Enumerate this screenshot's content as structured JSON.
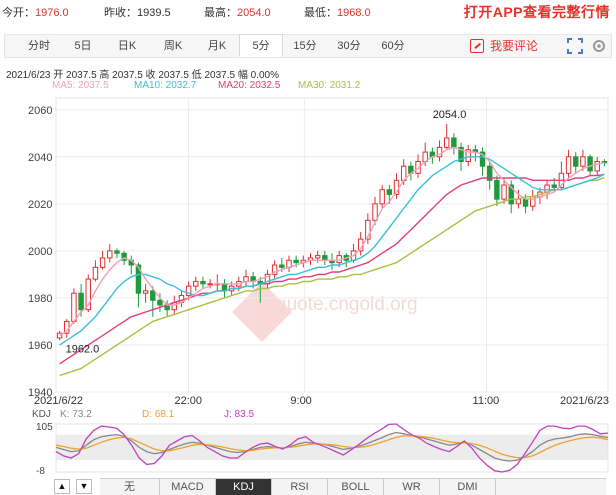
{
  "quote": {
    "open_label": "今开：",
    "open_value": "1976.0",
    "prev_label": "昨收：",
    "prev_value": "1939.5",
    "high_label": "最高：",
    "high_value": "2054.0",
    "low_label": "最低：",
    "low_value": "1968.0",
    "app_cta": "打开APP查看完整行情"
  },
  "tabs": [
    {
      "label": "分时"
    },
    {
      "label": "5日"
    },
    {
      "label": "日K"
    },
    {
      "label": "周K"
    },
    {
      "label": "月K"
    },
    {
      "label": "5分",
      "active": true
    },
    {
      "label": "15分"
    },
    {
      "label": "30分"
    },
    {
      "label": "60分"
    }
  ],
  "comment_label": "我要评论",
  "info_line": "2021/6/23  开 2037.5  高 2037.5  收 2037.5  低 2037.5  幅 0.00%",
  "ma": {
    "ma5": "MA5: 2037.5",
    "ma10": "MA10: 2032.7",
    "ma20": "MA20: 2032.5",
    "ma30": "MA30: 2031.2"
  },
  "colors": {
    "ma5": "#f0a0b8",
    "ma10": "#38c0d8",
    "ma20": "#e0407a",
    "ma30": "#a8c040",
    "up": "#e03030",
    "down": "#1f9a3c",
    "k": "#888888",
    "d": "#f0a030",
    "j": "#c040c0",
    "brand_red": "#e5322d"
  },
  "watermark": "quote.cngold.org",
  "kdj": {
    "label": "KDJ",
    "k": "K: 73.2",
    "d": "D: 68.1",
    "j": "J: 83.5"
  },
  "indicators": [
    {
      "label": "无"
    },
    {
      "label": "MACD"
    },
    {
      "label": "KDJ",
      "active": true
    },
    {
      "label": "RSI"
    },
    {
      "label": "BOLL"
    },
    {
      "label": "WR"
    },
    {
      "label": "DMI"
    }
  ],
  "nav": {
    "up": "▲",
    "down": "▼"
  },
  "chart_data": {
    "type": "candlestick",
    "ylim": [
      1940,
      2065
    ],
    "y_ticks": [
      "2060",
      "2040",
      "2020",
      "2000",
      "1980",
      "1960",
      "1940"
    ],
    "x_labels": [
      "2021/6/22",
      "22:00",
      "9:00",
      "11:00",
      "2021/6/23"
    ],
    "annotations": [
      {
        "text": "2054.0"
      },
      {
        "text": "1962.0"
      }
    ],
    "candles": [
      [
        1963,
        1965,
        1966,
        1962
      ],
      [
        1965,
        1970,
        1971,
        1963
      ],
      [
        1970,
        1982,
        1984,
        1969
      ],
      [
        1982,
        1975,
        1986,
        1972
      ],
      [
        1975,
        1988,
        1990,
        1974
      ],
      [
        1988,
        1993,
        1996,
        1987
      ],
      [
        1993,
        1997,
        2000,
        1992
      ],
      [
        1997,
        2000,
        2003,
        1995
      ],
      [
        2000,
        1999,
        2001,
        1997
      ],
      [
        1999,
        1996,
        2000,
        1994
      ],
      [
        1996,
        1994,
        1998,
        1990
      ],
      [
        1994,
        1982,
        1995,
        1976
      ],
      [
        1982,
        1983,
        1986,
        1978
      ],
      [
        1983,
        1979,
        1985,
        1972
      ],
      [
        1979,
        1977,
        1982,
        1974
      ],
      [
        1977,
        1975,
        1979,
        1972
      ],
      [
        1975,
        1978,
        1981,
        1973
      ],
      [
        1978,
        1981,
        1983,
        1976
      ],
      [
        1981,
        1985,
        1987,
        1979
      ],
      [
        1985,
        1987,
        1989,
        1983
      ],
      [
        1987,
        1986,
        1989,
        1984
      ],
      [
        1986,
        1986,
        1988,
        1984
      ],
      [
        1986,
        1986,
        1990,
        1983
      ],
      [
        1986,
        1983,
        1988,
        1980
      ],
      [
        1983,
        1985,
        1987,
        1981
      ],
      [
        1985,
        1987,
        1989,
        1983
      ],
      [
        1987,
        1989,
        1992,
        1985
      ],
      [
        1989,
        1987,
        1991,
        1984
      ],
      [
        1987,
        1986,
        1989,
        1978
      ],
      [
        1986,
        1990,
        1992,
        1984
      ],
      [
        1990,
        1994,
        1996,
        1988
      ],
      [
        1994,
        1993,
        1997,
        1991
      ],
      [
        1993,
        1996,
        1998,
        1991
      ],
      [
        1996,
        1995,
        1998,
        1993
      ],
      [
        1995,
        1996,
        1998,
        1993
      ],
      [
        1996,
        1997,
        1999,
        1994
      ],
      [
        1997,
        1998,
        2000,
        1995
      ],
      [
        1998,
        1996,
        2000,
        1994
      ],
      [
        1996,
        1995,
        1999,
        1992
      ],
      [
        1995,
        1998,
        2000,
        1993
      ],
      [
        1998,
        1996,
        1999,
        1993
      ],
      [
        1996,
        2000,
        2003,
        1995
      ],
      [
        2000,
        2005,
        2008,
        1998
      ],
      [
        2005,
        2013,
        2016,
        2003
      ],
      [
        2013,
        2020,
        2023,
        2011
      ],
      [
        2020,
        2026,
        2028,
        2018
      ],
      [
        2026,
        2024,
        2028,
        2020
      ],
      [
        2024,
        2030,
        2033,
        2022
      ],
      [
        2030,
        2036,
        2039,
        2028
      ],
      [
        2036,
        2033,
        2038,
        2030
      ],
      [
        2033,
        2038,
        2041,
        2031
      ],
      [
        2038,
        2042,
        2046,
        2036
      ],
      [
        2042,
        2040,
        2044,
        2037
      ],
      [
        2040,
        2044,
        2047,
        2038
      ],
      [
        2044,
        2048,
        2054,
        2043
      ],
      [
        2048,
        2044,
        2050,
        2041
      ],
      [
        2044,
        2038,
        2046,
        2034
      ],
      [
        2038,
        2043,
        2045,
        2036
      ],
      [
        2043,
        2042,
        2045,
        2038
      ],
      [
        2042,
        2036,
        2044,
        2032
      ],
      [
        2036,
        2030,
        2038,
        2026
      ],
      [
        2030,
        2022,
        2032,
        2019
      ],
      [
        2022,
        2028,
        2031,
        2020
      ],
      [
        2028,
        2020,
        2030,
        2016
      ],
      [
        2020,
        2022,
        2026,
        2018
      ],
      [
        2022,
        2019,
        2024,
        2016
      ],
      [
        2019,
        2023,
        2026,
        2017
      ],
      [
        2023,
        2025,
        2027,
        2020
      ],
      [
        2025,
        2028,
        2030,
        2022
      ],
      [
        2028,
        2027,
        2031,
        2025
      ],
      [
        2027,
        2033,
        2038,
        2026
      ],
      [
        2033,
        2040,
        2043,
        2031
      ],
      [
        2040,
        2036,
        2042,
        2033
      ],
      [
        2036,
        2040,
        2043,
        2034
      ],
      [
        2040,
        2034,
        2041,
        2032
      ],
      [
        2034,
        2038,
        2040,
        2032
      ],
      [
        2038,
        2037.5,
        2039,
        2036
      ]
    ],
    "ma5": [
      1964,
      1966,
      1970,
      1974,
      1977,
      1983,
      1988,
      1992,
      1995,
      1997,
      1996,
      1993,
      1988,
      1984,
      1980,
      1977,
      1977,
      1978,
      1980,
      1982,
      1984,
      1985,
      1986,
      1986,
      1986,
      1986,
      1987,
      1987,
      1988,
      1989,
      1991,
      1992,
      1993,
      1994,
      1995,
      1996,
      1996,
      1996,
      1996,
      1996,
      1997,
      1998,
      2001,
      2006,
      2012,
      2018,
      2021,
      2025,
      2030,
      2033,
      2035,
      2038,
      2040,
      2041,
      2043,
      2044,
      2043,
      2042,
      2042,
      2041,
      2038,
      2033,
      2030,
      2027,
      2024,
      2022,
      2022,
      2023,
      2024,
      2025,
      2028,
      2031,
      2033,
      2035,
      2036,
      2037,
      2037.5
    ],
    "ma10": [
      1960,
      1962,
      1964,
      1966,
      1969,
      1972,
      1976,
      1980,
      1984,
      1987,
      1989,
      1990,
      1990,
      1989,
      1988,
      1986,
      1985,
      1983,
      1982,
      1981,
      1981,
      1982,
      1983,
      1983,
      1984,
      1984,
      1985,
      1985,
      1986,
      1987,
      1988,
      1989,
      1990,
      1990,
      1991,
      1992,
      1993,
      1993,
      1994,
      1994,
      1995,
      1996,
      1997,
      1999,
      2002,
      2006,
      2010,
      2014,
      2018,
      2022,
      2026,
      2029,
      2032,
      2034,
      2036,
      2038,
      2039,
      2040,
      2040,
      2040,
      2039,
      2037,
      2035,
      2033,
      2031,
      2029,
      2027,
      2026,
      2026,
      2026,
      2026,
      2027,
      2028,
      2029,
      2030,
      2031,
      2032.7
    ],
    "ma20": [
      1952,
      1954,
      1956,
      1958,
      1960,
      1962,
      1964,
      1966,
      1968,
      1970,
      1972,
      1973,
      1974,
      1975,
      1976,
      1977,
      1978,
      1979,
      1980,
      1981,
      1982,
      1982,
      1983,
      1983,
      1984,
      1984,
      1985,
      1985,
      1986,
      1986,
      1987,
      1987,
      1988,
      1988,
      1989,
      1989,
      1990,
      1990,
      1991,
      1991,
      1992,
      1993,
      1994,
      1995,
      1997,
      1999,
      2001,
      2003,
      2006,
      2009,
      2012,
      2015,
      2018,
      2021,
      2024,
      2026,
      2028,
      2029,
      2030,
      2031,
      2031,
      2031,
      2031,
      2031,
      2031,
      2031,
      2030,
      2030,
      2030,
      2030,
      2030,
      2030,
      2031,
      2031,
      2032,
      2032,
      2032.5
    ],
    "ma30": [
      1947,
      1948,
      1949,
      1950,
      1952,
      1954,
      1956,
      1958,
      1960,
      1962,
      1964,
      1966,
      1968,
      1970,
      1971,
      1972,
      1973,
      1974,
      1975,
      1976,
      1977,
      1978,
      1979,
      1980,
      1981,
      1982,
      1983,
      1983,
      1984,
      1984,
      1985,
      1985,
      1986,
      1986,
      1987,
      1987,
      1988,
      1988,
      1988,
      1989,
      1989,
      1990,
      1990,
      1991,
      1992,
      1993,
      1994,
      1995,
      1997,
      1999,
      2001,
      2003,
      2005,
      2007,
      2009,
      2011,
      2013,
      2015,
      2017,
      2018,
      2019,
      2020,
      2021,
      2022,
      2022,
      2023,
      2023,
      2024,
      2025,
      2026,
      2026,
      2027,
      2028,
      2029,
      2030,
      2030,
      2031.2
    ],
    "kdj": {
      "ylim": [
        -8,
        105
      ],
      "y_ticks": [
        "105",
        "-8"
      ],
      "k": [
        50,
        45,
        40,
        42,
        55,
        68,
        75,
        78,
        80,
        76,
        65,
        50,
        40,
        35,
        38,
        45,
        52,
        58,
        62,
        60,
        55,
        50,
        45,
        40,
        38,
        40,
        45,
        50,
        52,
        50,
        48,
        52,
        58,
        62,
        60,
        58,
        55,
        50,
        45,
        48,
        52,
        58,
        65,
        72,
        80,
        85,
        82,
        78,
        75,
        70,
        65,
        60,
        55,
        58,
        62,
        55,
        45,
        35,
        25,
        20,
        18,
        20,
        28,
        40,
        55,
        65,
        70,
        72,
        75,
        80,
        82,
        80,
        76,
        73.2
      ],
      "d": [
        55,
        52,
        48,
        46,
        48,
        55,
        62,
        68,
        72,
        74,
        70,
        62,
        54,
        46,
        42,
        42,
        46,
        50,
        55,
        57,
        56,
        54,
        51,
        47,
        44,
        42,
        43,
        46,
        48,
        49,
        49,
        50,
        53,
        56,
        58,
        58,
        57,
        55,
        52,
        50,
        50,
        52,
        56,
        62,
        68,
        74,
        77,
        77,
        76,
        74,
        71,
        67,
        63,
        61,
        61,
        59,
        55,
        49,
        41,
        34,
        29,
        26,
        26,
        30,
        38,
        47,
        55,
        61,
        66,
        70,
        73,
        74,
        72,
        68.1
      ],
      "j": [
        40,
        30,
        25,
        35,
        70,
        90,
        100,
        98,
        95,
        80,
        55,
        25,
        10,
        12,
        30,
        55,
        65,
        75,
        78,
        65,
        50,
        40,
        30,
        25,
        25,
        38,
        50,
        58,
        60,
        52,
        46,
        56,
        70,
        75,
        62,
        55,
        48,
        40,
        32,
        44,
        56,
        70,
        82,
        92,
        104,
        105,
        92,
        80,
        72,
        60,
        52,
        45,
        40,
        52,
        65,
        48,
        25,
        8,
        -5,
        -8,
        -4,
        10,
        35,
        62,
        90,
        100,
        100,
        95,
        94,
        100,
        100,
        92,
        82,
        83.5
      ]
    }
  }
}
